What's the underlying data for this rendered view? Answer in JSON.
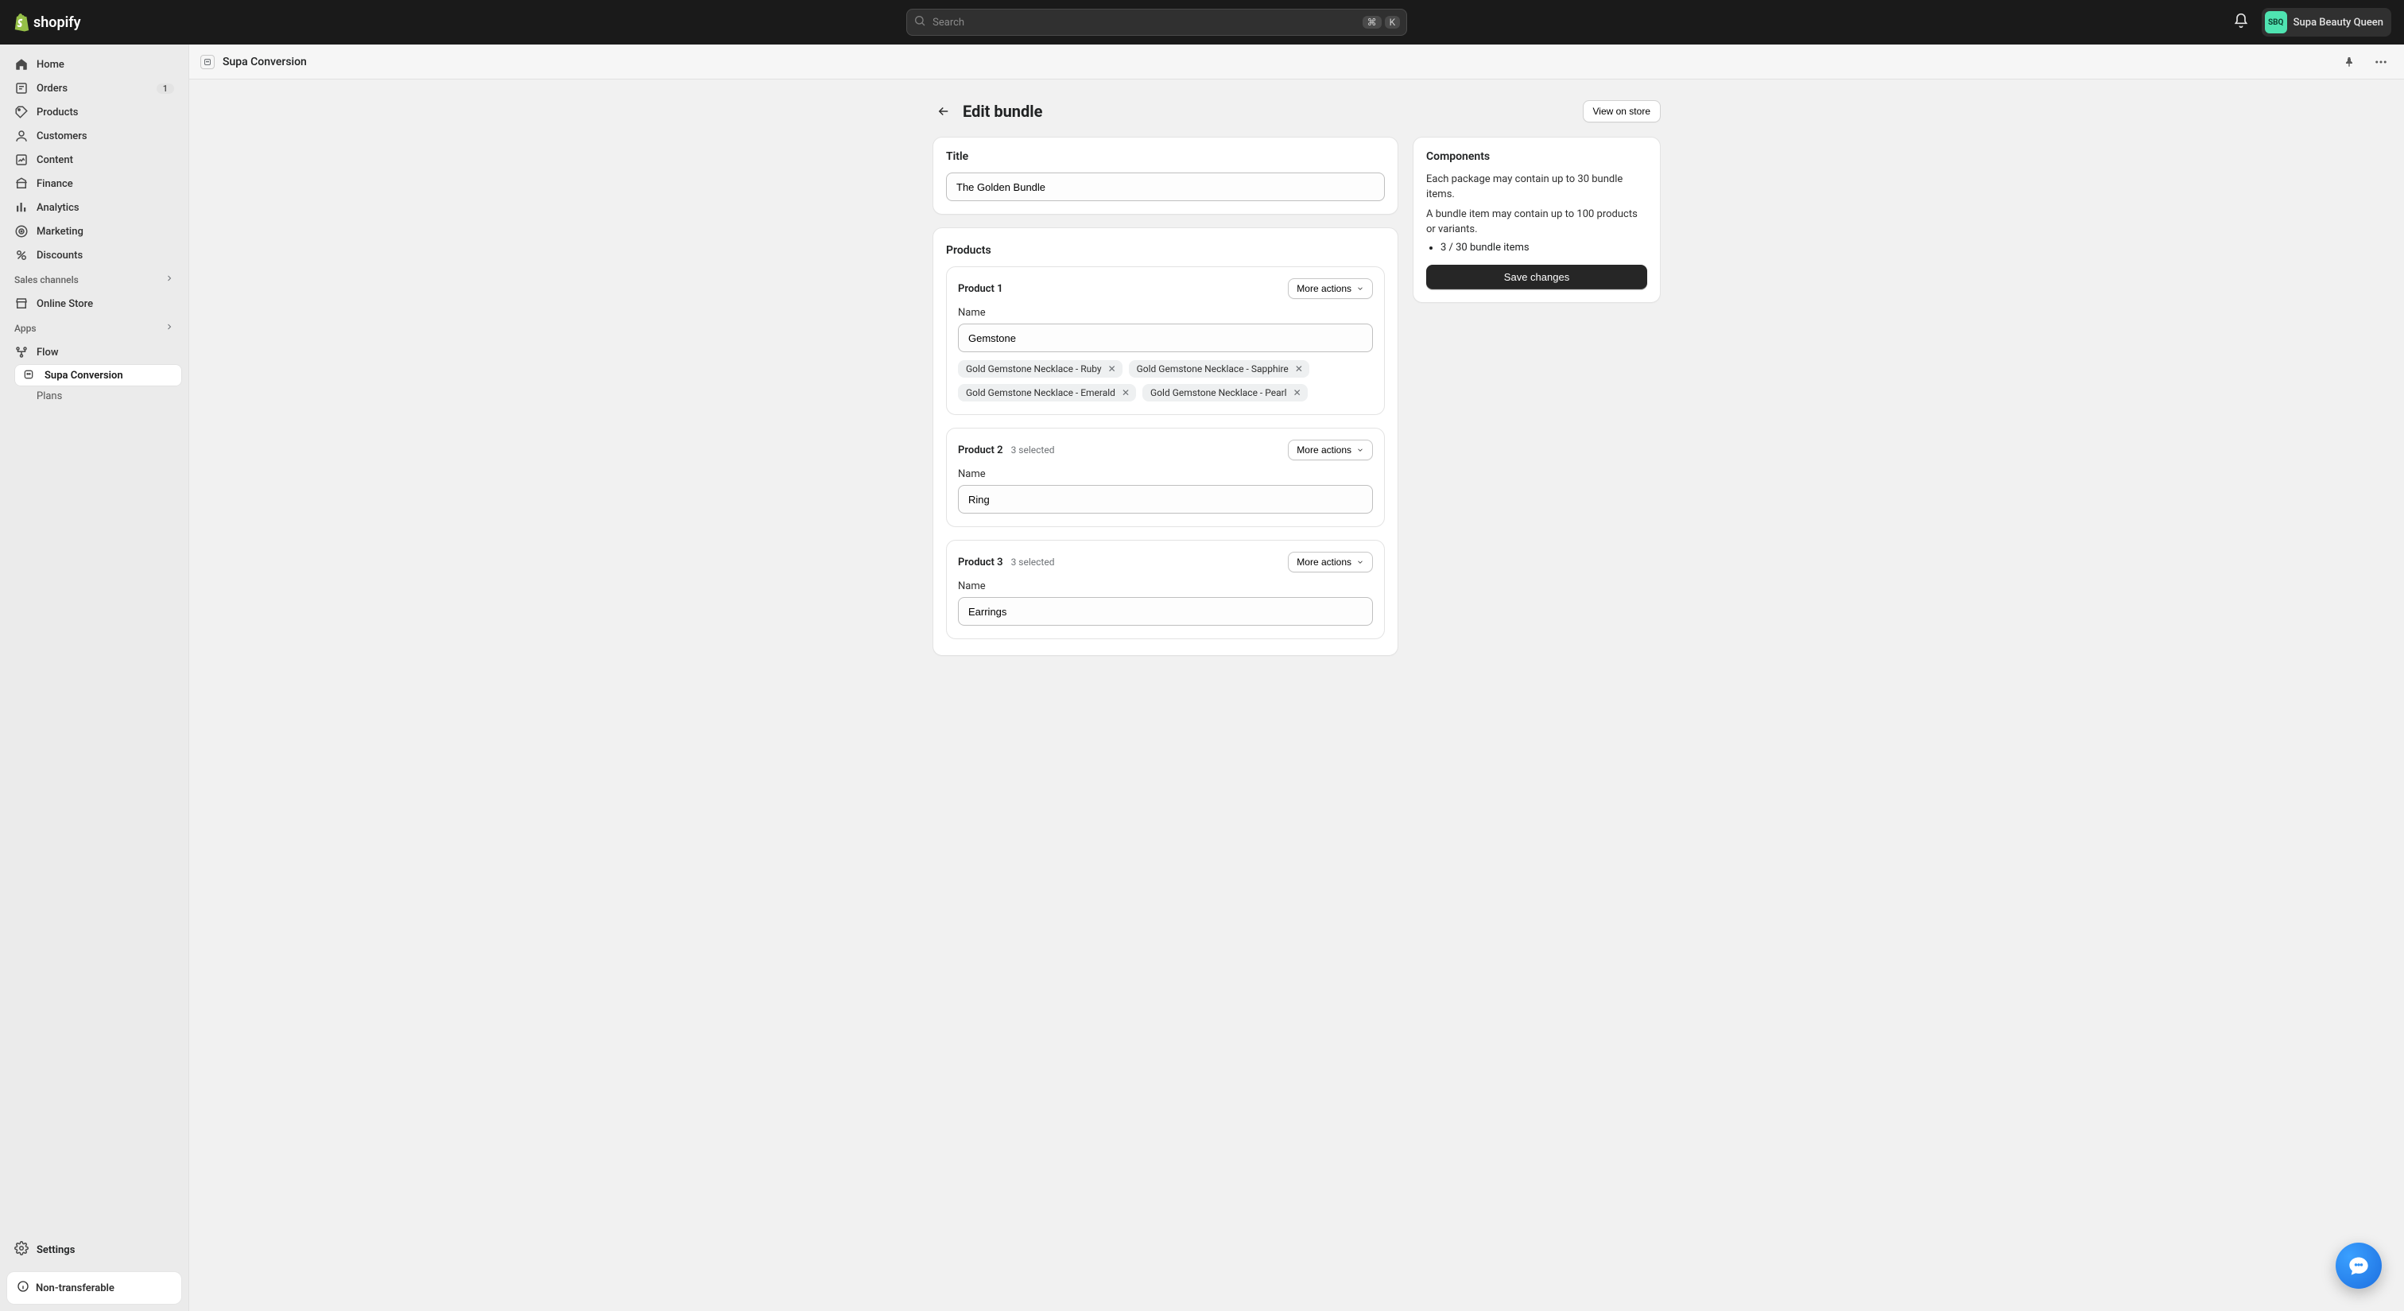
{
  "topbar": {
    "brand": "shopify",
    "search_placeholder": "Search",
    "shortcut_mod": "⌘",
    "shortcut_key": "K",
    "store_initials": "SBQ",
    "store_name": "Supa Beauty Queen"
  },
  "sidebar": {
    "items": [
      {
        "id": "home",
        "label": "Home"
      },
      {
        "id": "orders",
        "label": "Orders",
        "badge": "1"
      },
      {
        "id": "products",
        "label": "Products"
      },
      {
        "id": "customers",
        "label": "Customers"
      },
      {
        "id": "content",
        "label": "Content"
      },
      {
        "id": "finance",
        "label": "Finance"
      },
      {
        "id": "analytics",
        "label": "Analytics"
      },
      {
        "id": "marketing",
        "label": "Marketing"
      },
      {
        "id": "discounts",
        "label": "Discounts"
      }
    ],
    "sales_channels_header": "Sales channels",
    "sales_channels": [
      {
        "id": "online-store",
        "label": "Online Store"
      }
    ],
    "apps_header": "Apps",
    "apps": [
      {
        "id": "flow",
        "label": "Flow"
      },
      {
        "id": "supa-conversion",
        "label": "Supa Conversion",
        "active": true
      },
      {
        "id": "plans",
        "label": "Plans",
        "sub": true
      }
    ],
    "settings_label": "Settings",
    "nontransferable_label": "Non-transferable"
  },
  "app_header": {
    "title": "Supa Conversion"
  },
  "page": {
    "title": "Edit bundle",
    "view_btn": "View on store",
    "title_card": {
      "heading": "Title",
      "value": "The Golden Bundle"
    },
    "products_heading": "Products",
    "more_actions_label": "More actions",
    "name_label": "Name",
    "products": [
      {
        "heading": "Product 1",
        "selected_meta": "",
        "name_value": "Gemstone",
        "tags": [
          "Gold Gemstone Necklace - Ruby",
          "Gold Gemstone Necklace - Sapphire",
          "Gold Gemstone Necklace - Emerald",
          "Gold Gemstone Necklace - Pearl"
        ]
      },
      {
        "heading": "Product 2",
        "selected_meta": "3 selected",
        "name_value": "Ring",
        "tags": []
      },
      {
        "heading": "Product 3",
        "selected_meta": "3 selected",
        "name_value": "Earrings",
        "tags": []
      }
    ],
    "side": {
      "heading": "Components",
      "line1": "Each package may contain up to 30 bundle items.",
      "line2": "A bundle item may contain up to 100 products or variants.",
      "bullet": "3 / 30 bundle items",
      "save_btn": "Save changes"
    }
  }
}
